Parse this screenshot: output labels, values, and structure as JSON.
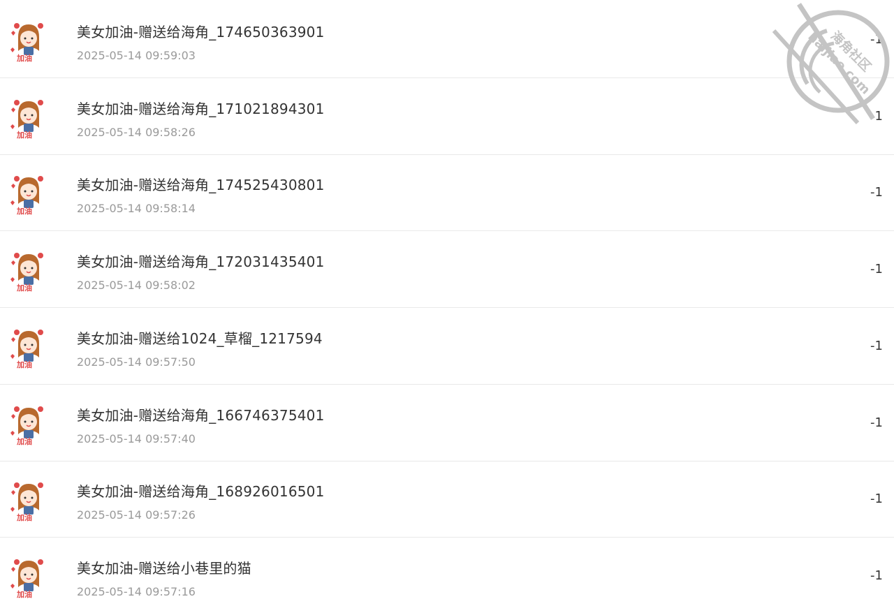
{
  "records": [
    {
      "title": "美女加油-赠送给海角_174650363901",
      "time": "2025-05-14 09:59:03",
      "amount": "-1"
    },
    {
      "title": "美女加油-赠送给海角_171021894301",
      "time": "2025-05-14 09:58:26",
      "amount": "-1"
    },
    {
      "title": "美女加油-赠送给海角_174525430801",
      "time": "2025-05-14 09:58:14",
      "amount": "-1"
    },
    {
      "title": "美女加油-赠送给海角_172031435401",
      "time": "2025-05-14 09:58:02",
      "amount": "-1"
    },
    {
      "title": "美女加油-赠送给1024_草榴_1217594",
      "time": "2025-05-14 09:57:50",
      "amount": "-1"
    },
    {
      "title": "美女加油-赠送给海角_166746375401",
      "time": "2025-05-14 09:57:40",
      "amount": "-1"
    },
    {
      "title": "美女加油-赠送给海角_168926016501",
      "time": "2025-05-14 09:57:26",
      "amount": "-1"
    },
    {
      "title": "美女加油-赠送给小巷里的猫",
      "time": "2025-05-14 09:57:16",
      "amount": "-1"
    }
  ],
  "watermark": {
    "line1": "海角社区",
    "line2": "haijiao.com"
  },
  "avatar_icon": "girl-cheering-sticker",
  "colors": {
    "title": "#333333",
    "time": "#9a9a9a",
    "divider": "#e9e9e9",
    "watermark": "#bdbdbd",
    "sticker_red": "#e04b4b",
    "sticker_hair": "#b8692e"
  }
}
